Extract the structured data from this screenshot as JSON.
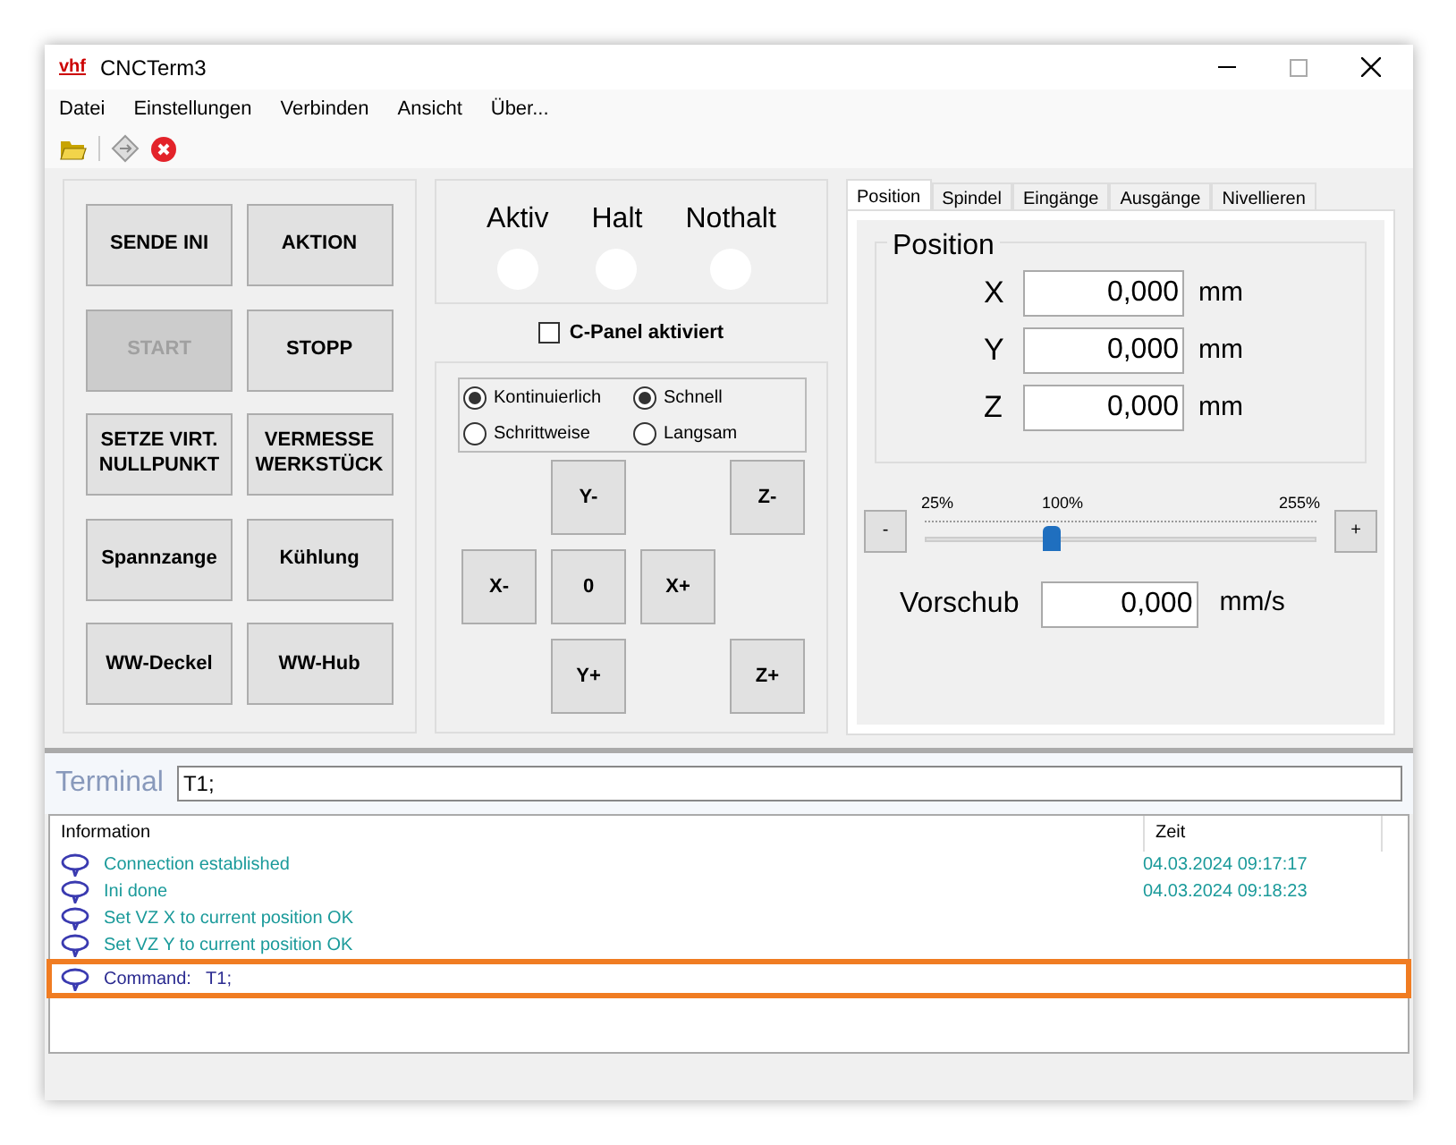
{
  "window": {
    "logo": "vhf",
    "title": "CNCTerm3"
  },
  "menu": [
    "Datei",
    "Einstellungen",
    "Verbinden",
    "Ansicht",
    "Über..."
  ],
  "actions": [
    {
      "label": "SENDE INI",
      "disabled": false
    },
    {
      "label": "AKTION",
      "disabled": false
    },
    {
      "label": "START",
      "disabled": true
    },
    {
      "label": "STOPP",
      "disabled": false
    },
    {
      "label": "SETZE VIRT. NULLPUNKT",
      "disabled": false
    },
    {
      "label": "VERMESSE WERKSTÜCK",
      "disabled": false
    },
    {
      "label": "Spannzange",
      "disabled": false
    },
    {
      "label": "Kühlung",
      "disabled": false
    },
    {
      "label": "WW-Deckel",
      "disabled": false
    },
    {
      "label": "WW-Hub",
      "disabled": false
    }
  ],
  "indicators": [
    {
      "label": "Aktiv"
    },
    {
      "label": "Halt"
    },
    {
      "label": "Nothalt"
    }
  ],
  "c_panel": {
    "label": "C-Panel aktiviert",
    "checked": false
  },
  "modes": [
    {
      "label": "Kontinuierlich",
      "selected": true
    },
    {
      "label": "Schrittweise",
      "selected": false
    }
  ],
  "speeds": [
    {
      "label": "Schnell",
      "selected": true
    },
    {
      "label": "Langsam",
      "selected": false
    }
  ],
  "jog": {
    "y_minus": "Y-",
    "z_minus": "Z-",
    "x_minus": "X-",
    "zero": "0",
    "x_plus": "X+",
    "y_plus": "Y+",
    "z_plus": "Z+"
  },
  "tabs": [
    {
      "label": "Position",
      "selected": true
    },
    {
      "label": "Spindel",
      "selected": false
    },
    {
      "label": "Eingänge",
      "selected": false
    },
    {
      "label": "Ausgänge",
      "selected": false
    },
    {
      "label": "Nivellieren",
      "selected": false
    }
  ],
  "position": {
    "title": "Position",
    "axes": [
      {
        "axis": "X",
        "value": "0,000",
        "unit": "mm"
      },
      {
        "axis": "Y",
        "value": "0,000",
        "unit": "mm"
      },
      {
        "axis": "Z",
        "value": "0,000",
        "unit": "mm"
      }
    ]
  },
  "override": {
    "min": "25%",
    "mid": "100%",
    "max": "255%",
    "minus": "-",
    "plus": "+",
    "level": 0.326
  },
  "feed": {
    "label": "Vorschub",
    "value": "0,000",
    "unit": "mm/s"
  },
  "terminal": {
    "label": "Terminal",
    "value": "T1;"
  },
  "log": {
    "columns": [
      "Information",
      "Zeit"
    ],
    "rows": [
      {
        "text": "Connection established",
        "time": "04.03.2024 09:17:17",
        "selected": false
      },
      {
        "text": "Ini done",
        "time": "04.03.2024 09:18:23",
        "selected": false
      },
      {
        "text": "Set VZ X to current position OK",
        "selected": false
      },
      {
        "text": "Set VZ Y to current position OK",
        "selected": false
      },
      {
        "text": "Command:   T1;",
        "selected": true
      }
    ]
  }
}
